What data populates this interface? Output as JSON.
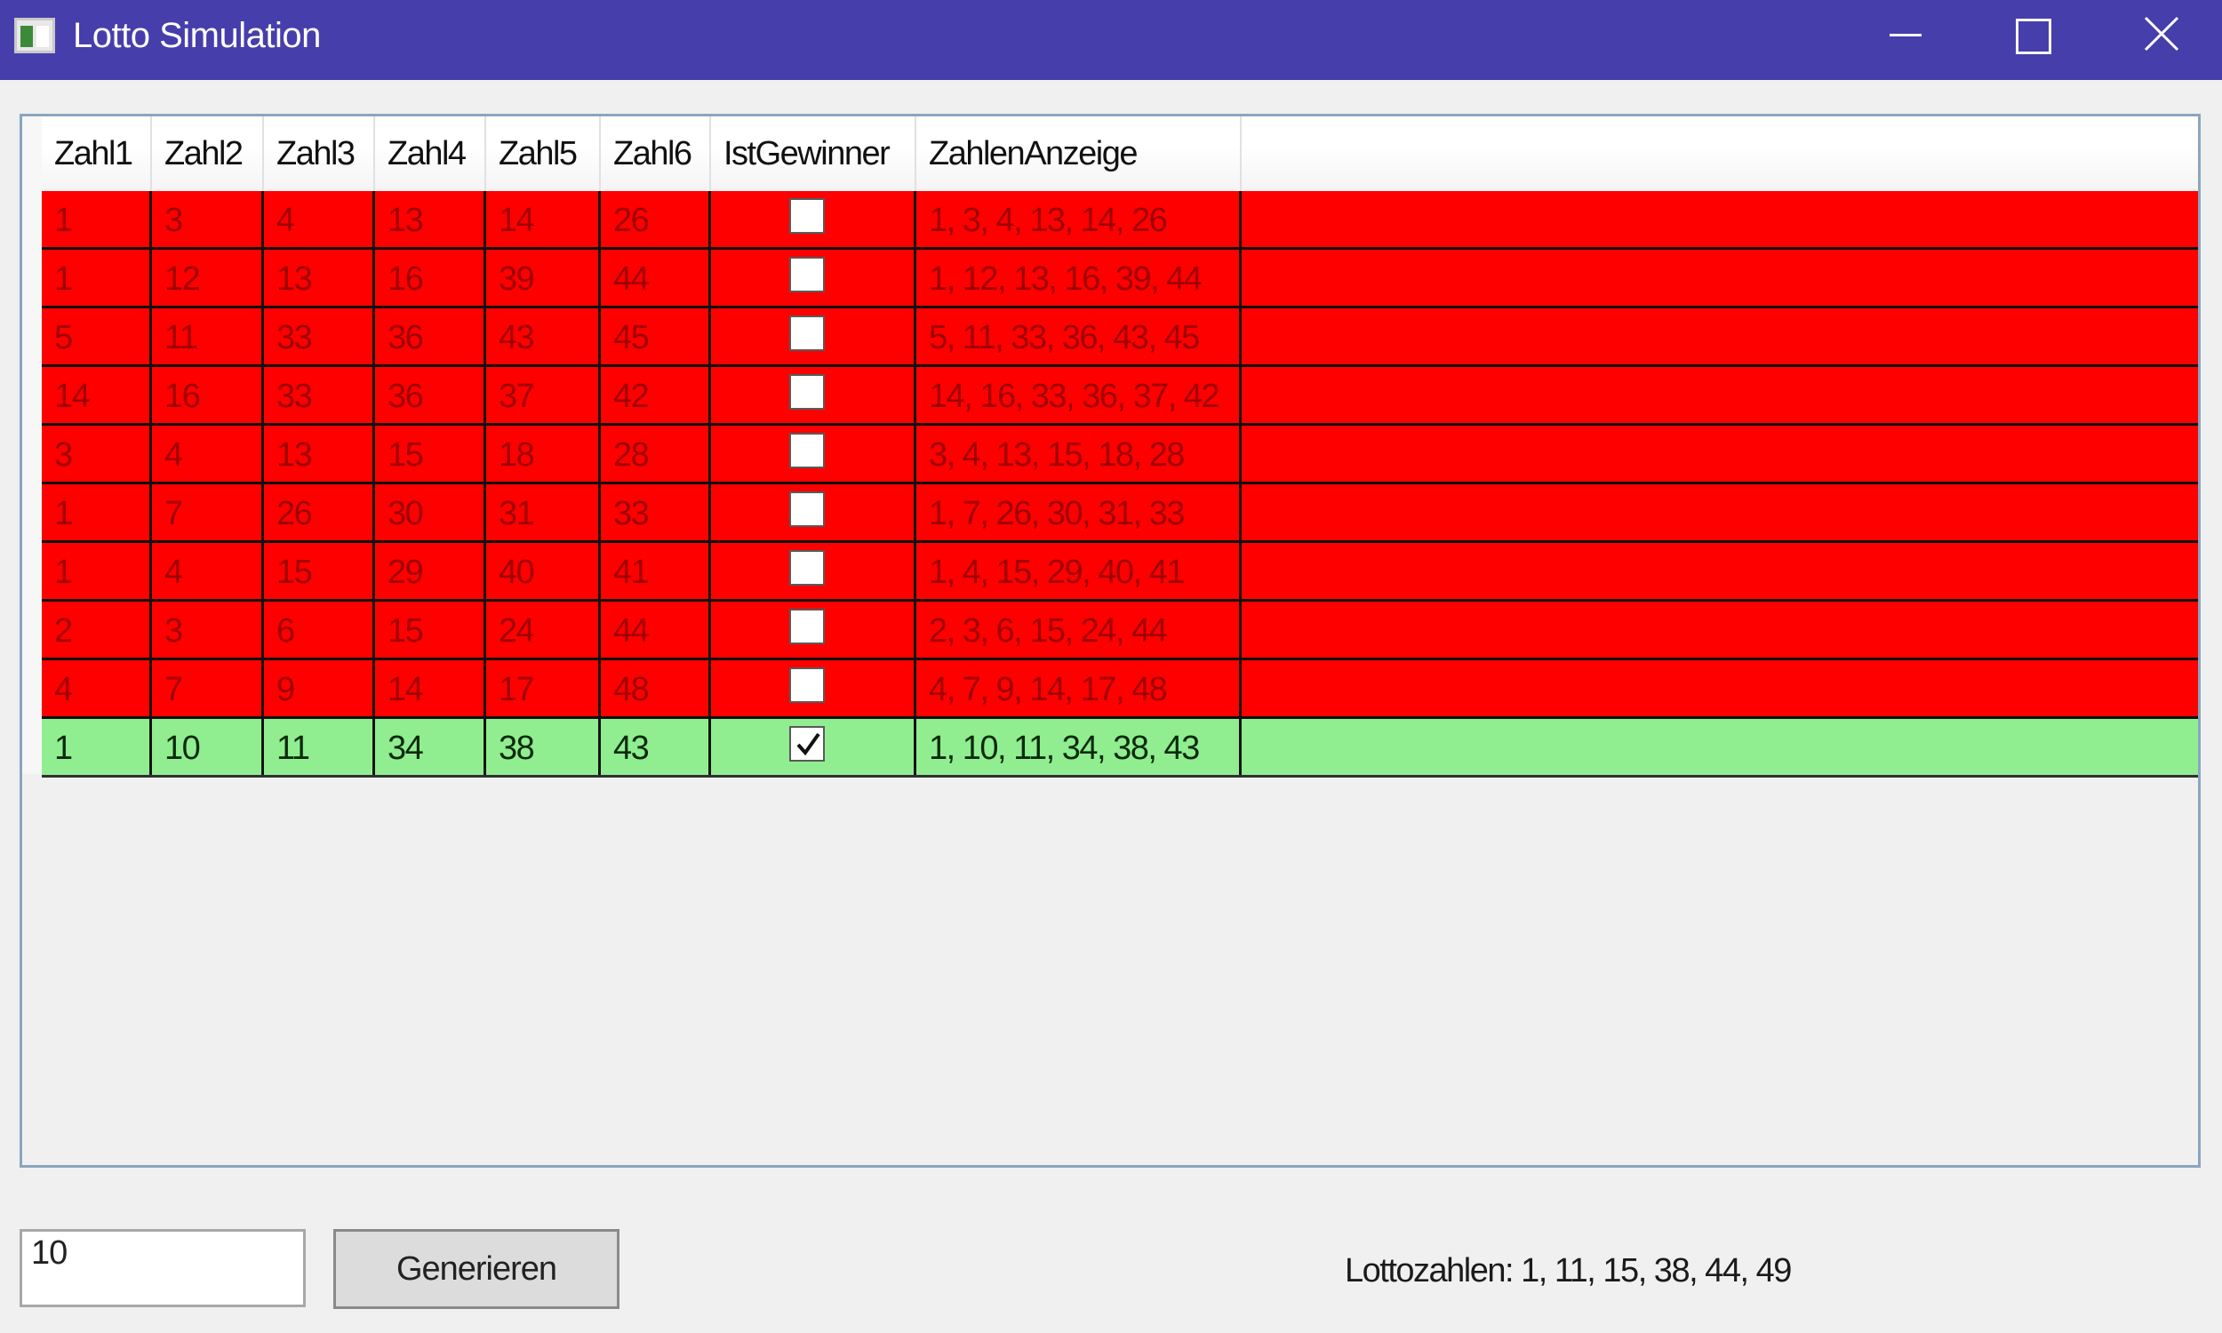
{
  "window": {
    "title": "Lotto Simulation"
  },
  "grid": {
    "columns": [
      "Zahl1",
      "Zahl2",
      "Zahl3",
      "Zahl4",
      "Zahl5",
      "Zahl6",
      "IstGewinner",
      "ZahlenAnzeige"
    ],
    "rows": [
      {
        "z1": "1",
        "z2": "3",
        "z3": "4",
        "z4": "13",
        "z5": "14",
        "z6": "26",
        "winner": false,
        "display": "1, 3, 4, 13, 14, 26"
      },
      {
        "z1": "1",
        "z2": "12",
        "z3": "13",
        "z4": "16",
        "z5": "39",
        "z6": "44",
        "winner": false,
        "display": "1, 12, 13, 16, 39, 44"
      },
      {
        "z1": "5",
        "z2": "11",
        "z3": "33",
        "z4": "36",
        "z5": "43",
        "z6": "45",
        "winner": false,
        "display": "5, 11, 33, 36, 43, 45"
      },
      {
        "z1": "14",
        "z2": "16",
        "z3": "33",
        "z4": "36",
        "z5": "37",
        "z6": "42",
        "winner": false,
        "display": "14, 16, 33, 36, 37, 42"
      },
      {
        "z1": "3",
        "z2": "4",
        "z3": "13",
        "z4": "15",
        "z5": "18",
        "z6": "28",
        "winner": false,
        "display": "3, 4, 13, 15, 18, 28"
      },
      {
        "z1": "1",
        "z2": "7",
        "z3": "26",
        "z4": "30",
        "z5": "31",
        "z6": "33",
        "winner": false,
        "display": "1, 7, 26, 30, 31, 33"
      },
      {
        "z1": "1",
        "z2": "4",
        "z3": "15",
        "z4": "29",
        "z5": "40",
        "z6": "41",
        "winner": false,
        "display": "1, 4, 15, 29, 40, 41"
      },
      {
        "z1": "2",
        "z2": "3",
        "z3": "6",
        "z4": "15",
        "z5": "24",
        "z6": "44",
        "winner": false,
        "display": "2, 3, 6, 15, 24, 44"
      },
      {
        "z1": "4",
        "z2": "7",
        "z3": "9",
        "z4": "14",
        "z5": "17",
        "z6": "48",
        "winner": false,
        "display": "4, 7, 9, 14, 17, 48"
      },
      {
        "z1": "1",
        "z2": "10",
        "z3": "11",
        "z4": "34",
        "z5": "38",
        "z6": "43",
        "winner": true,
        "display": "1, 10, 11, 34, 38, 43"
      }
    ],
    "colors": {
      "loser_row": "#ff0000",
      "winner_row": "#90ee90"
    }
  },
  "controls": {
    "count_value": "10",
    "generate_label": "Generieren",
    "lottozahlen_text": "Lottozahlen: 1, 11, 15, 38, 44, 49"
  },
  "icons": {
    "app": "app-icon",
    "minimize": "minimize-icon",
    "maximize": "maximize-icon",
    "close": "close-icon",
    "check": "checkmark-icon"
  }
}
